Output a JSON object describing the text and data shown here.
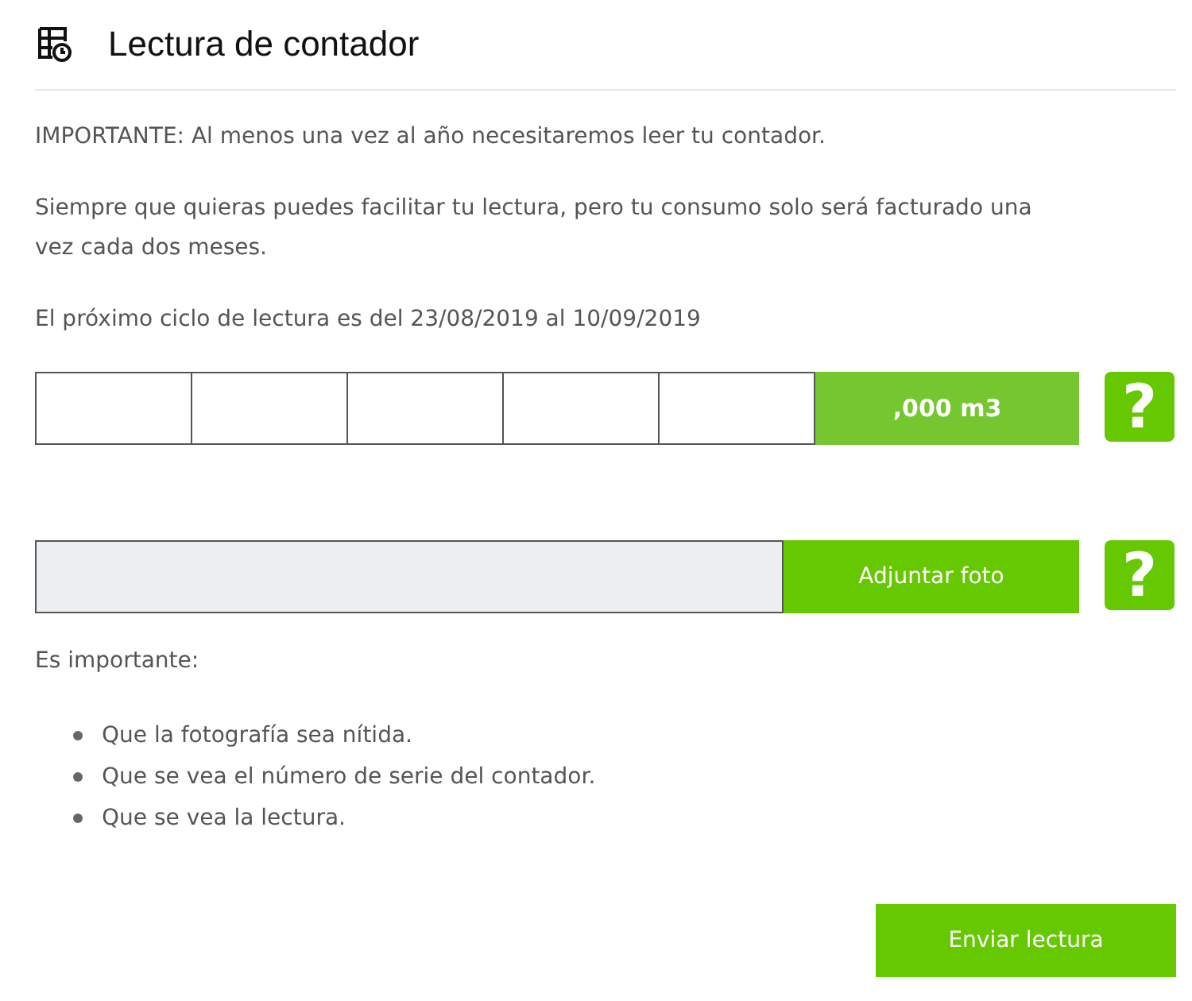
{
  "header": {
    "title": "Lectura de contador"
  },
  "paragraphs": [
    "IMPORTANTE: Al menos una vez al año necesitaremos leer tu contador.",
    "Siempre que quieras puedes facilitar tu lectura, pero tu consumo solo será facturado una vez cada dos meses.",
    "El próximo ciclo de lectura es del 23/08/2019 al 10/09/2019"
  ],
  "reading": {
    "unit": ",000 m3",
    "help": "?"
  },
  "photo": {
    "button": "Adjuntar foto",
    "help": "?"
  },
  "tips": {
    "title": "Es importante:",
    "items": [
      "Que la fotografía sea nítida.",
      "Que se vea el número de serie del contador.",
      "Que se vea la lectura."
    ]
  },
  "submit": "Enviar lectura"
}
